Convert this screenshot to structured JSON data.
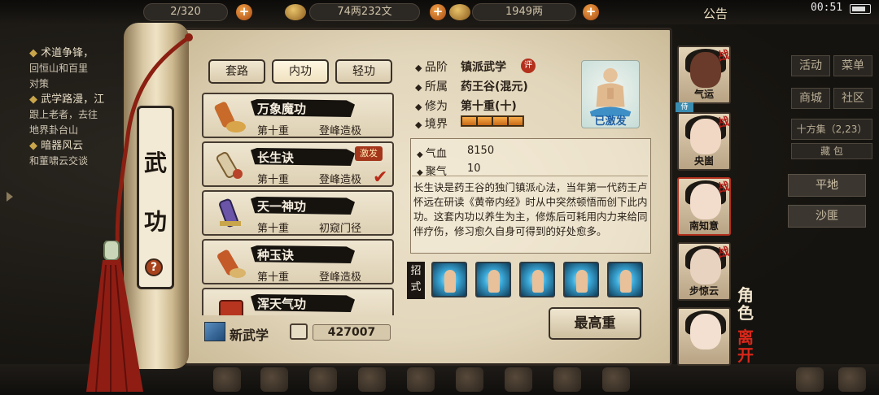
{
  "hud": {
    "progress_text": "2/320",
    "currency_text": "74两232文",
    "gold_text": "1949两",
    "notice_label": "公告",
    "clock": "00:51"
  },
  "quests": {
    "q1_title": "术道争锋，",
    "q1_line1": "回恒山和百里",
    "q1_line2": "对策",
    "q2_title": "武学路漫，江",
    "q2_line1": "跟上老者，去往",
    "q2_line2": "地界卦台山",
    "q3_title": "暗器风云",
    "q3_line1": "和董啸云交谈"
  },
  "right_menu": {
    "btn1": "活动",
    "btn2": "菜单",
    "btn3": "商城",
    "btn4": "社区",
    "btn5": "十方集（2,23）",
    "btn6": "藏 包",
    "terrain1": "平地",
    "terrain2": "沙匪"
  },
  "scroll": {
    "title_char1": "武",
    "title_char2": "功",
    "help": "?"
  },
  "tabs": [
    "套路",
    "内功",
    "轻功"
  ],
  "skills": [
    {
      "name": "万象魔功",
      "level": "第十重",
      "stage": "登峰造极",
      "badge": "",
      "checked": false
    },
    {
      "name": "长生诀",
      "level": "第十重",
      "stage": "登峰造极",
      "badge": "激发",
      "checked": true
    },
    {
      "name": "天一神功",
      "level": "第十重",
      "stage": "初窥门径",
      "badge": "",
      "checked": false
    },
    {
      "name": "种玉诀",
      "level": "第十重",
      "stage": "登峰造极",
      "badge": "",
      "checked": false
    },
    {
      "name": "浑天气功",
      "level": "",
      "stage": "",
      "badge": "",
      "checked": false
    }
  ],
  "footer": {
    "new_skill_label": "新武学",
    "points_value": "427007"
  },
  "detail": {
    "grade_key": "品阶",
    "grade_val": "镇派武学",
    "eval_badge": "评",
    "belong_key": "所属",
    "belong_val": "药王谷(混元)",
    "cult_key": "修为",
    "cult_val": "第十重(十)",
    "realm_key": "境界",
    "realm_segments": 4,
    "portrait_label": "已激发",
    "qixue_key": "气血",
    "qixue_val": "8150",
    "juqi_key": "聚气",
    "juqi_val": "10",
    "description": "长生诀是药王谷的独门镇派心法，当年第一代药王卢怀远在研读《黄帝内经》时从中突然顿悟而创下此内功。这套内功以养生为主，修炼后可耗用内力来给同伴疗伤，修习愈久自身可得到的好处愈多。",
    "moves_label": "招式",
    "max_button": "最高重"
  },
  "characters": [
    {
      "name": "气运",
      "battle": "战",
      "rank": "侍"
    },
    {
      "name": "央崮",
      "battle": "战"
    },
    {
      "name": "南知意",
      "battle": "战"
    },
    {
      "name": "步惊云",
      "battle": "战"
    },
    {
      "name": "",
      "battle": ""
    }
  ],
  "side": {
    "role_char1": "角",
    "role_char2": "色",
    "leave_char1": "离",
    "leave_char2": "开"
  },
  "colors": {
    "accent_red": "#b21d17",
    "paper": "#e6dbc1",
    "ink": "#2a2118",
    "move_blue": "#3aa7d6"
  }
}
